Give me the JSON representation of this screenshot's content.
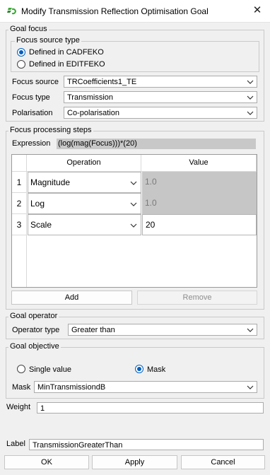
{
  "window": {
    "title": "Modify Transmission Reflection Optimisation Goal",
    "close_glyph": "✕"
  },
  "goal_focus": {
    "label": "Goal focus",
    "source_type": {
      "label": "Focus source type",
      "options": [
        "Defined in CADFEKO",
        "Defined in EDITFEKO"
      ],
      "selected": "Defined in CADFEKO"
    },
    "focus_source": {
      "label": "Focus source",
      "value": "TRCoefficients1_TE"
    },
    "focus_type": {
      "label": "Focus type",
      "value": "Transmission"
    },
    "polarisation": {
      "label": "Polarisation",
      "value": "Co-polarisation"
    }
  },
  "processing": {
    "label": "Focus processing steps",
    "expression_label": "Expression",
    "expression_value": "(log(mag(Focus)))*(20)",
    "columns": [
      "Operation",
      "Value"
    ],
    "rows": [
      {
        "num": "1",
        "operation": "Magnitude",
        "value": "1.0",
        "editable": false
      },
      {
        "num": "2",
        "operation": "Log",
        "value": "1.0",
        "editable": false
      },
      {
        "num": "3",
        "operation": "Scale",
        "value": "20",
        "editable": true
      }
    ],
    "add_label": "Add",
    "remove_label": "Remove"
  },
  "operator": {
    "label": "Goal operator",
    "type_label": "Operator type",
    "type_value": "Greater than"
  },
  "objective": {
    "label": "Goal objective",
    "options": [
      "Single value",
      "Mask"
    ],
    "selected": "Mask",
    "mask_label": "Mask",
    "mask_value": "MinTransmissiondB"
  },
  "weight": {
    "label": "Weight",
    "value": "1"
  },
  "goal_label": {
    "label": "Label",
    "value": "TransmissionGreaterThan"
  },
  "buttons": {
    "ok": "OK",
    "apply": "Apply",
    "cancel": "Cancel"
  },
  "colors": {
    "accent": "#0060c0",
    "disabled_cell": "#c6c6c6",
    "expression_bg": "#c8c8c8"
  }
}
